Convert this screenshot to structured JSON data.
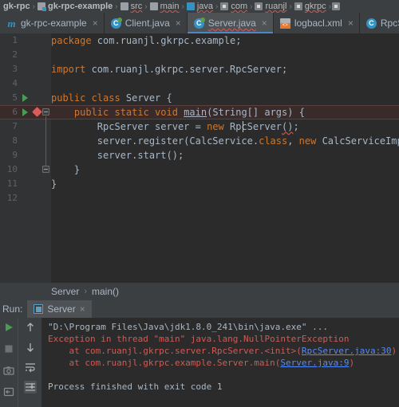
{
  "breadcrumb": {
    "items": [
      {
        "label": "gk-rpc",
        "icon": "none",
        "bold": true,
        "squiggle": false
      },
      {
        "label": "gk-rpc-example",
        "icon": "module-icon",
        "bold": true,
        "squiggle": false
      },
      {
        "label": "src",
        "icon": "folder-icon",
        "bold": false,
        "squiggle": true
      },
      {
        "label": "main",
        "icon": "folder-icon",
        "bold": false,
        "squiggle": true
      },
      {
        "label": "java",
        "icon": "java-source-root-icon",
        "bold": false,
        "squiggle": true
      },
      {
        "label": "com",
        "icon": "package-icon",
        "bold": false,
        "squiggle": true
      },
      {
        "label": "ruanjl",
        "icon": "package-icon",
        "bold": false,
        "squiggle": true
      },
      {
        "label": "gkrpc",
        "icon": "package-icon",
        "bold": false,
        "squiggle": true
      }
    ],
    "separator": "›"
  },
  "tabs": {
    "close_glyph": "×",
    "items": [
      {
        "label": "gk-rpc-example",
        "icon": "maven-icon",
        "active": false,
        "squiggle": false
      },
      {
        "label": "Client.java",
        "icon": "java-class-run-icon",
        "active": false,
        "squiggle": false
      },
      {
        "label": "Server.java",
        "icon": "java-class-run-icon",
        "active": true,
        "squiggle": true
      },
      {
        "label": "logbacl.xml",
        "icon": "xml-file-icon",
        "active": false,
        "squiggle": false
      },
      {
        "label": "RpcSer",
        "icon": "java-class-icon",
        "active": false,
        "squiggle": false
      }
    ]
  },
  "editor": {
    "line_numbers": [
      "1",
      "2",
      "3",
      "4",
      "5",
      "6",
      "7",
      "8",
      "9",
      "10",
      "11",
      "12"
    ],
    "lines": [
      {
        "n": "1",
        "indent": 0,
        "segments": [
          {
            "t": "package",
            "c": "kw"
          },
          {
            "t": " com.ruanjl.gkrpc.example;",
            "c": "plain"
          }
        ]
      },
      {
        "n": "2",
        "indent": 0,
        "segments": []
      },
      {
        "n": "3",
        "indent": 0,
        "segments": [
          {
            "t": "import",
            "c": "kw"
          },
          {
            "t": " com.ruanjl.gkrpc.server.RpcServer;",
            "c": "plain"
          }
        ]
      },
      {
        "n": "4",
        "indent": 0,
        "segments": []
      },
      {
        "n": "5",
        "indent": 0,
        "segments": [
          {
            "t": "public class",
            "c": "kw"
          },
          {
            "t": " Server {",
            "c": "plain"
          }
        ]
      },
      {
        "n": "6",
        "indent": 1,
        "segments": [
          {
            "t": "public static void",
            "c": "kw"
          },
          {
            "t": " ",
            "c": "plain"
          },
          {
            "t": "main",
            "c": "fn-main"
          },
          {
            "t": "(String[] args) {",
            "c": "plain"
          }
        ]
      },
      {
        "n": "7",
        "indent": 2,
        "segments": [
          {
            "t": "RpcServer server = ",
            "c": "plain"
          },
          {
            "t": "new",
            "c": "kw"
          },
          {
            "t": " RpcServer",
            "c": "plain"
          },
          {
            "t": "()",
            "c": "err-squig"
          },
          {
            "t": ";",
            "c": "plain"
          }
        ]
      },
      {
        "n": "8",
        "indent": 2,
        "segments": [
          {
            "t": "server.register(CalcService.",
            "c": "plain"
          },
          {
            "t": "class",
            "c": "kw"
          },
          {
            "t": ", ",
            "c": "plain"
          },
          {
            "t": "new",
            "c": "kw"
          },
          {
            "t": " CalcServiceImpl());",
            "c": "plain"
          }
        ]
      },
      {
        "n": "9",
        "indent": 2,
        "segments": [
          {
            "t": "server.start();",
            "c": "plain"
          }
        ]
      },
      {
        "n": "10",
        "indent": 1,
        "segments": [
          {
            "t": "}",
            "c": "plain"
          }
        ]
      },
      {
        "n": "11",
        "indent": 0,
        "segments": [
          {
            "t": "}",
            "c": "plain"
          }
        ]
      },
      {
        "n": "12",
        "indent": 0,
        "segments": []
      }
    ],
    "gutter_markers": [
      {
        "line": 5,
        "type": "run-gutter-icon"
      },
      {
        "line": 6,
        "type": "run-gutter-icon"
      },
      {
        "line": 6,
        "type": "breakpoint-icon"
      },
      {
        "line": 6,
        "type": "fold-collapse-icon"
      },
      {
        "line": 10,
        "type": "fold-collapse-icon"
      }
    ],
    "highlighted_line": 6
  },
  "method_breadcrumb": {
    "class": "Server",
    "separator": "›",
    "method": "main()"
  },
  "run_panel": {
    "label": "Run:",
    "tab_label": "Server",
    "close_glyph": "×",
    "toolbar_left": [
      "rerun-icon",
      "stop-icon",
      "camera-icon",
      "export-icon"
    ],
    "toolbar_right": [
      "scroll-up-icon",
      "scroll-down-icon",
      "soft-wrap-icon",
      "scroll-to-end-icon"
    ],
    "console": [
      {
        "type": "cmd",
        "text": "\"D:\\Program Files\\Java\\jdk1.8.0_241\\bin\\java.exe\" ..."
      },
      {
        "type": "err",
        "text": "Exception in thread \"main\" java.lang.NullPointerException"
      },
      {
        "type": "err-link",
        "prefix": "    at com.ruanjl.gkrpc.server.RpcServer.<init>(",
        "link": "RpcServer.java:30",
        "suffix": ")"
      },
      {
        "type": "err-link",
        "prefix": "    at com.ruanjl.gkrpc.example.Server.main(",
        "link": "Server.java:9",
        "suffix": ")"
      },
      {
        "type": "blank",
        "text": ""
      },
      {
        "type": "info",
        "text": "Process finished with exit code 1"
      }
    ]
  },
  "colors": {
    "editor_bg": "#2b2b2b",
    "gutter_bg": "#313335",
    "chrome_bg": "#3c3f41",
    "text": "#a9b7c6",
    "keyword": "#cc7832",
    "error": "#cf5b56",
    "link": "#548af7",
    "accent": "#4a88c7",
    "run_green": "#499c54",
    "breakpoint_red": "#db5c5c"
  }
}
